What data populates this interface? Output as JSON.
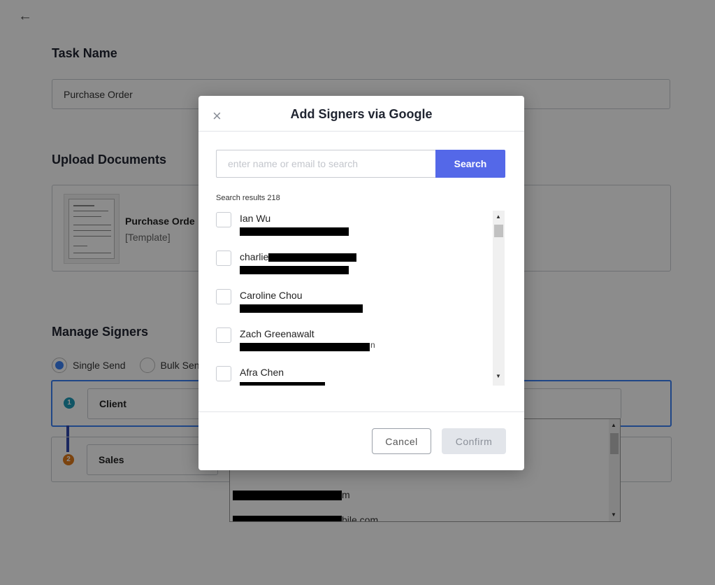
{
  "page": {
    "task_name_heading": "Task Name",
    "task_name_value": "Purchase Order",
    "upload_heading": "Upload Documents",
    "document": {
      "name": "Purchase Orde",
      "type": "[Template]"
    },
    "manage_heading": "Manage Signers",
    "send_modes": [
      {
        "label": "Single Send",
        "selected": true
      },
      {
        "label": "Bulk Sen",
        "selected": false
      }
    ],
    "signers": [
      {
        "number": "1",
        "role": "Client",
        "color": "#1e9bb8"
      },
      {
        "number": "2",
        "role": "Sales",
        "color": "#e07b1a"
      }
    ],
    "dropdown_items": [
      {
        "suffix": "m"
      },
      {
        "suffix": "bile.com"
      }
    ]
  },
  "modal": {
    "title": "Add Signers via Google",
    "close_icon": "close-icon",
    "search_placeholder": "enter name or email to search",
    "search_button": "Search",
    "results_label": "Search results 218",
    "results": [
      {
        "name": "Ian Wu"
      },
      {
        "name": "charlie",
        "name_suffix": ""
      },
      {
        "name": "Caroline Chou"
      },
      {
        "name": "Zach Greenawalt",
        "email_suffix": "n"
      },
      {
        "name": "Afra Chen"
      }
    ],
    "cancel_button": "Cancel",
    "confirm_button": "Confirm"
  },
  "colors": {
    "accent": "#5468e8",
    "selected_border": "#3b82f6",
    "overlay": "rgba(0,0,0,0.45)"
  }
}
